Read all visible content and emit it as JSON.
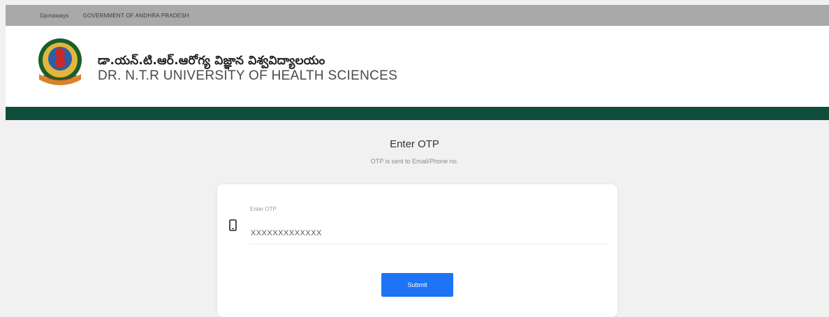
{
  "topbar": {
    "links": [
      "Gpmaways",
      "GOVERNMENT OF ANDHRA PRADESH"
    ]
  },
  "header": {
    "university_name_telugu": "డా.యన్.టి.ఆర్.ఆరోగ్య విజ్ఞాన విశ్వవిద్యాలయం",
    "university_name_english": "DR. N.T.R UNIVERSITY OF HEALTH SCIENCES",
    "logo_icon": "university-emblem-icon"
  },
  "page": {
    "title": "Enter OTP",
    "subtitle": "OTP is sent to Email/Phone no."
  },
  "form": {
    "field_label": "Enter OTP",
    "otp_value": "XXXXXXXXXXXXX",
    "field_icon": "mobile-phone-icon",
    "submit_label": "Submit"
  },
  "colors": {
    "topbar": "#a9a9a9",
    "greenbar": "#0e4d3b",
    "submit_button": "#1d74f5",
    "background": "#f1f1f1"
  }
}
